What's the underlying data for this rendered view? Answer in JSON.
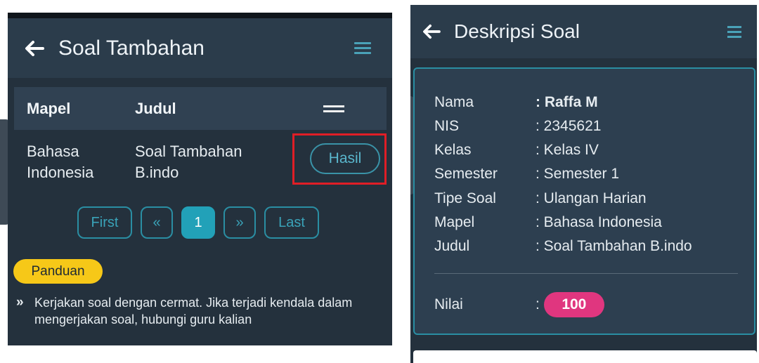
{
  "left": {
    "title": "Soal Tambahan",
    "table": {
      "headers": [
        "Mapel",
        "Judul"
      ],
      "rows": [
        {
          "mapel_line1": "Bahasa",
          "mapel_line2": "Indonesia",
          "judul_line1": "Soal Tambahan",
          "judul_line2": "B.indo",
          "action": "Hasil"
        }
      ]
    },
    "pagination": [
      "First",
      "«",
      "1",
      "»",
      "Last"
    ],
    "badge": "Panduan",
    "note_icon": "»",
    "note": "Kerjakan soal dengan cermat. Jika terjadi kendala dalam mengerjakan soal, hubungi guru kalian"
  },
  "right": {
    "title": "Deskripsi Soal",
    "fields": [
      {
        "label": "Nama",
        "value": ": Raffa M"
      },
      {
        "label": "NIS",
        "value": ": 2345621"
      },
      {
        "label": "Kelas",
        "value": ": Kelas IV"
      },
      {
        "label": "Semester",
        "value": ": Semester 1"
      },
      {
        "label": "Tipe Soal",
        "value": ": Ulangan Harian"
      },
      {
        "label": "Mapel",
        "value": ": Bahasa Indonesia"
      },
      {
        "label": "Judul",
        "value": ": Soal Tambahan B.indo"
      }
    ],
    "nilai_label": "Nilai",
    "nilai_colon": ":",
    "nilai_value": "100"
  },
  "colors": {
    "accent": "#22a1b8",
    "highlight": "#e01e26",
    "badge": "#f6c818",
    "pill": "#e0367f"
  },
  "icons": {
    "back": "arrow-left-icon",
    "menu": "hamburger-menu-icon"
  }
}
